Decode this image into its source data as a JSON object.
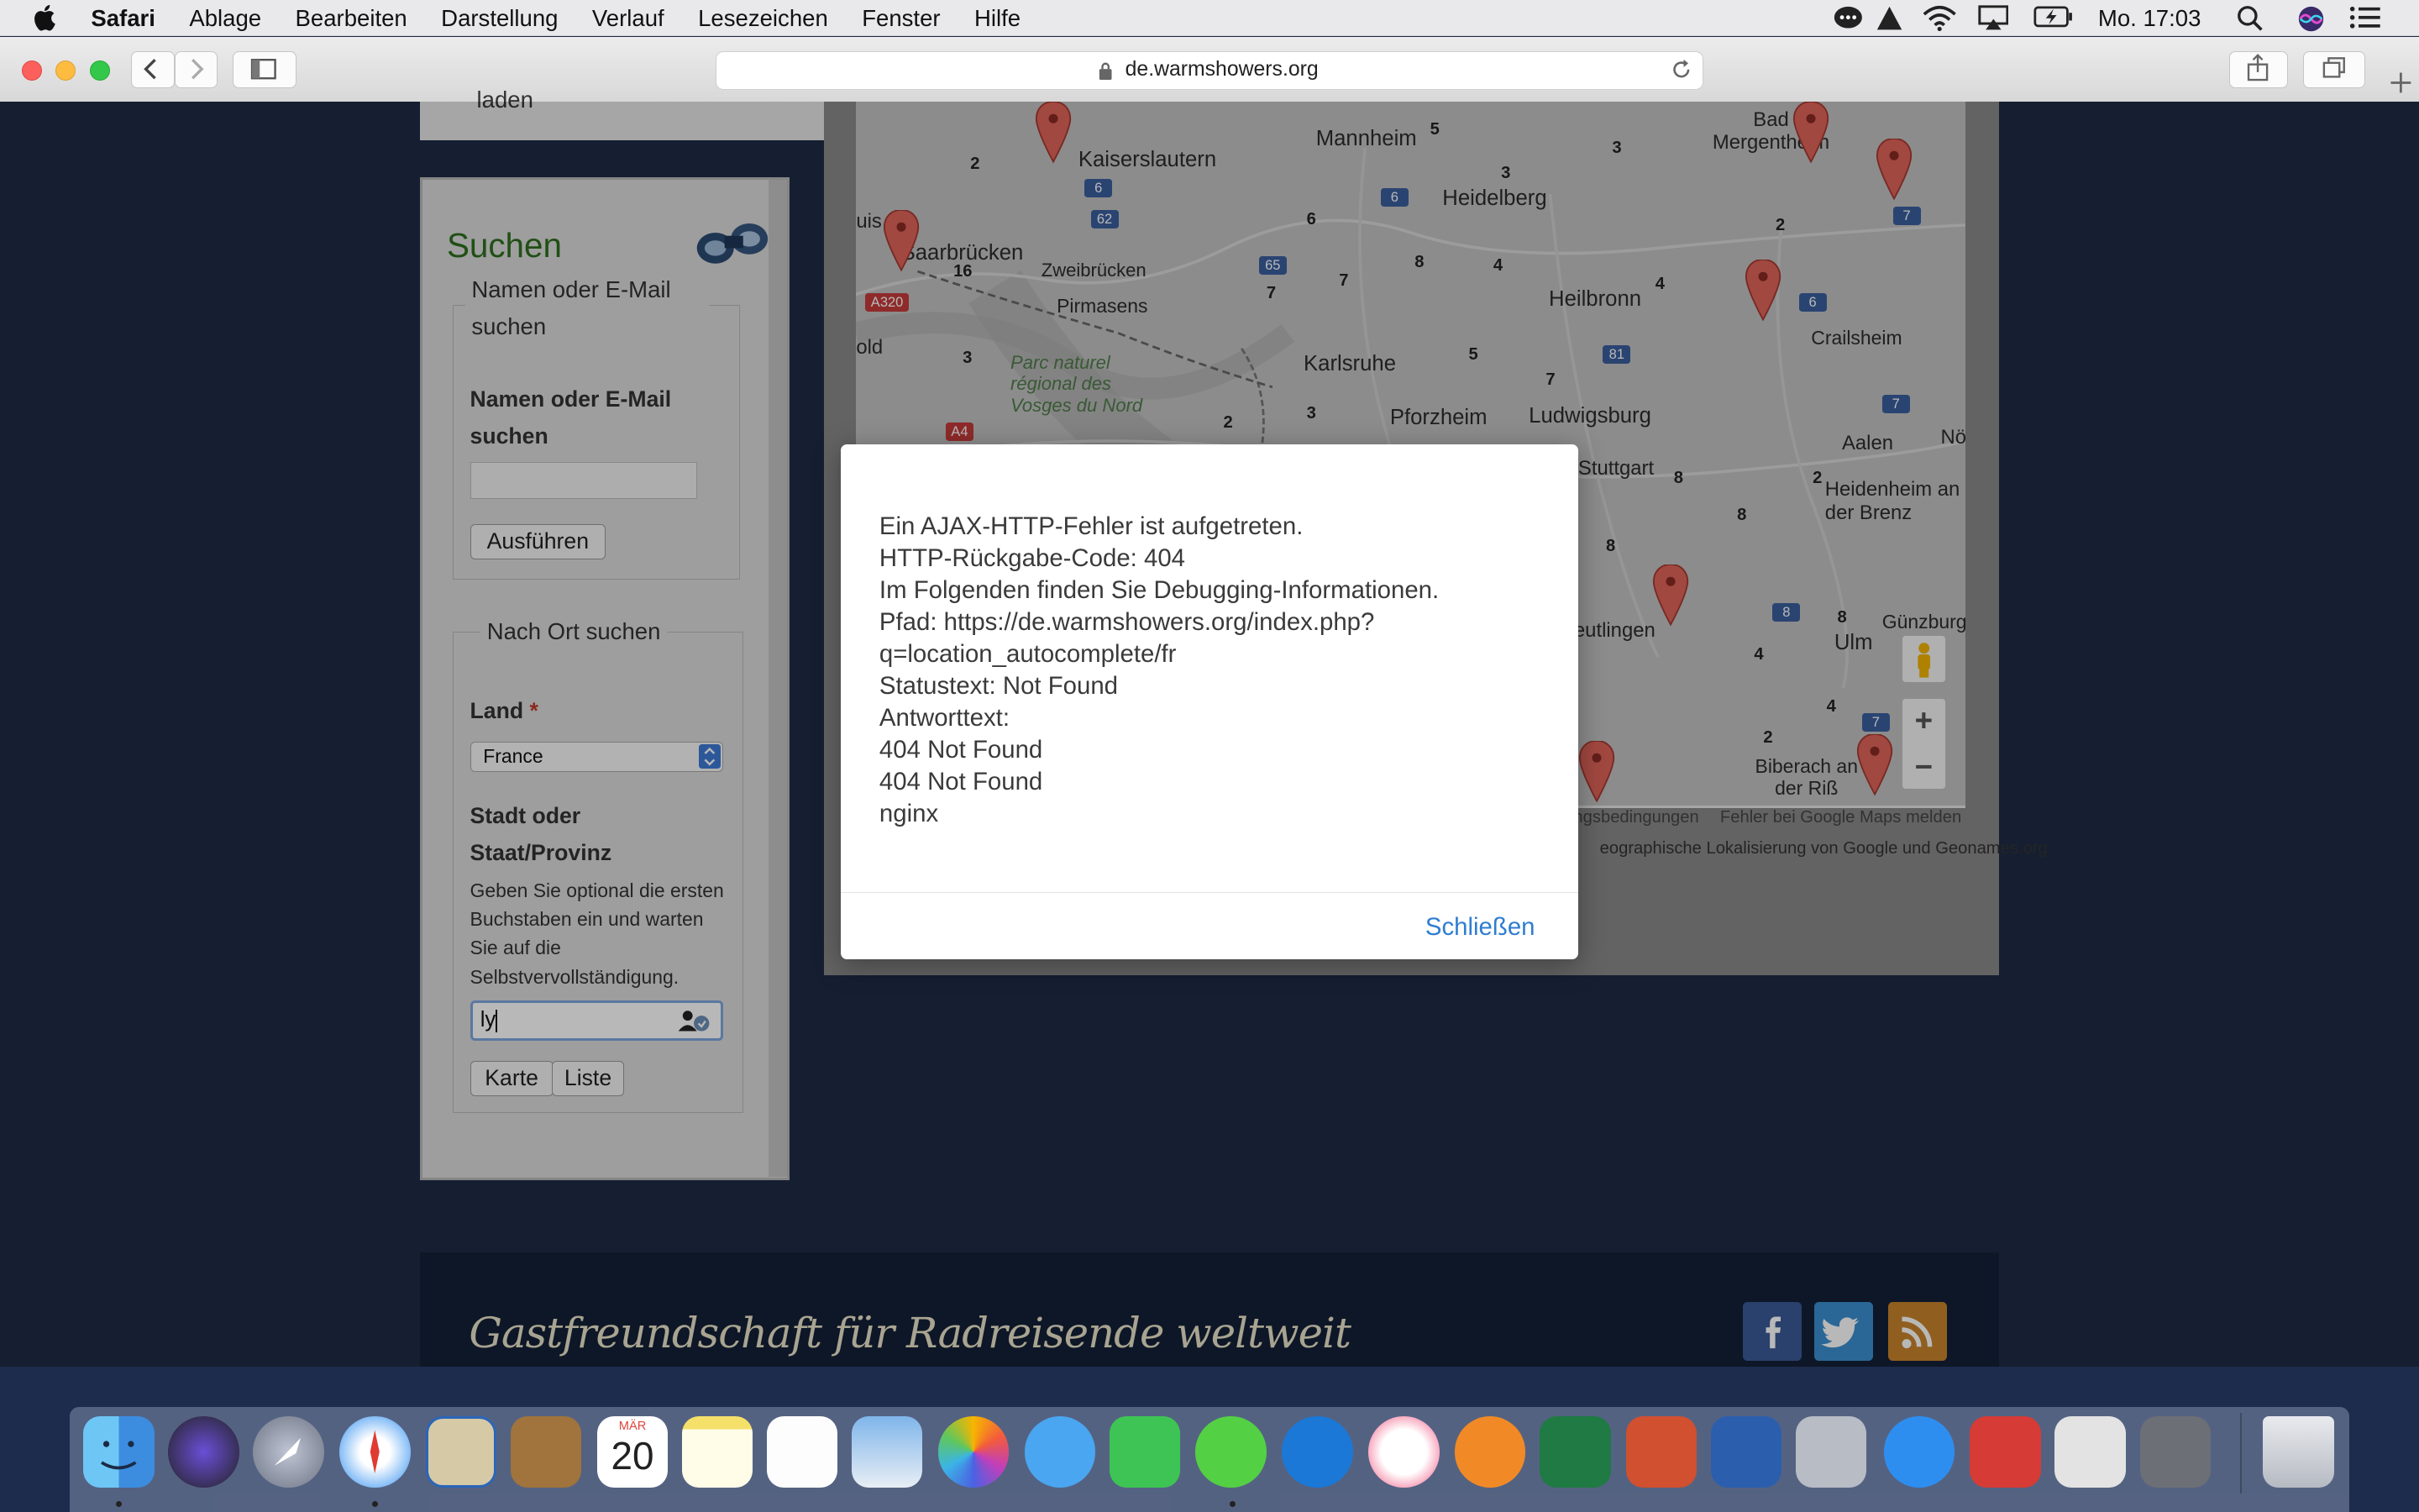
{
  "menubar": {
    "app": "Safari",
    "items": [
      "Ablage",
      "Bearbeiten",
      "Darstellung",
      "Verlauf",
      "Lesezeichen",
      "Fenster",
      "Hilfe"
    ],
    "clock": "Mo. 17:03"
  },
  "browser": {
    "url": "de.warmshowers.org"
  },
  "page": {
    "top_fragment": "laden",
    "search": {
      "title": "Suchen",
      "name_legend": "Namen oder E-Mail suchen",
      "name_label": "Namen oder E-Mail suchen",
      "name_value": "",
      "submit_label": "Ausführen",
      "place_legend": "Nach Ort suchen",
      "country_label": "Land",
      "required_mark": "*",
      "country_value": "France",
      "city_label": "Stadt oder Staat/Provinz",
      "city_help": "Geben Sie optional die ersten Buchstaben ein und warten Sie auf die Selbstvervollständigung.",
      "city_value": "ly",
      "map_button": "Karte",
      "list_button": "Liste"
    },
    "map": {
      "places": [
        "Kaiserslautern",
        "Mannheim",
        "Heidelberg",
        "Bad Mergentheim",
        "Saarbrücken",
        "Zweibrücken",
        "Pirmasens",
        "Heilbronn",
        "Crailsheim",
        "Parc naturel régional des Vosges du Nord",
        "Karlsruhe",
        "Pforzheim",
        "Ludwigsburg",
        "Aalen",
        "Heidenheim an der Brenz",
        "Ulm",
        "Günzburg",
        "Biberach an der Riß",
        "Reutlingen",
        "Stuttgart",
        "Nö",
        "old",
        "uis"
      ],
      "attribution_terms": "ngsbedingungen",
      "report": "Fehler bei Google Maps melden",
      "geo_credit": "eographische Lokalisierung von Google und Geonames.org",
      "zoom_in": "+",
      "zoom_out": "−"
    },
    "footer": {
      "tagline": "Gastfreundschaft für Radreisende weltweit"
    }
  },
  "dialog": {
    "lines": [
      "Ein AJAX-HTTP-Fehler ist aufgetreten.",
      "HTTP-Rückgabe-Code: 404",
      "Im Folgenden finden Sie Debugging-Informationen.",
      "Pfad: https://de.warmshowers.org/index.php?",
      "q=location_autocomplete/fr",
      "Statustext: Not Found",
      "Antworttext:",
      "404 Not Found",
      "404 Not Found",
      "nginx"
    ],
    "close_label": "Schließen"
  },
  "dock": {
    "calendar_month": "MÄR",
    "calendar_day": "20"
  },
  "colors": {
    "page_bg": "#1e2b45",
    "accent_link": "#2f7dd0",
    "search_title": "#2e6e1e",
    "facebook": "#3b5998",
    "twitter": "#3b8fd0",
    "rss": "#c8842c"
  }
}
